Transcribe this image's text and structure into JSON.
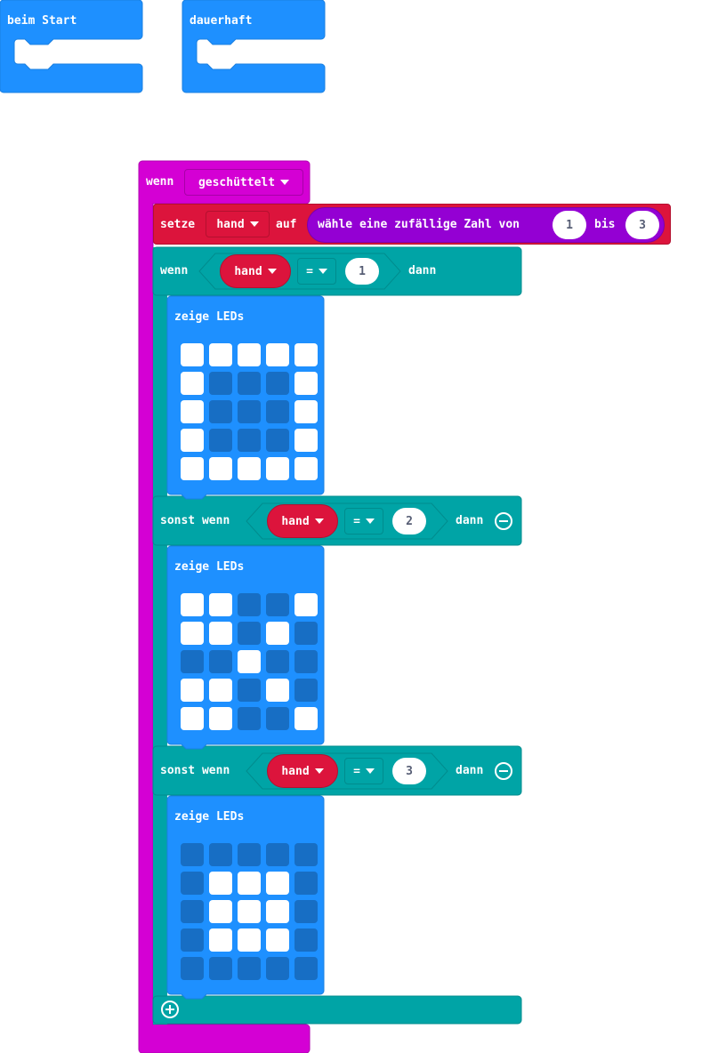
{
  "top_blocks": {
    "on_start_label": "beim Start",
    "forever_label": "dauerhaft"
  },
  "event": {
    "label": "wenn",
    "gesture": "geschüttelt"
  },
  "set_block": {
    "label": "setze",
    "variable": "hand",
    "to_label": "auf",
    "random_label": "wähle eine zufällige Zahl von",
    "from": "1",
    "between_label": "bis",
    "to": "3"
  },
  "if_block": {
    "if_label": "wenn",
    "then_label": "dann",
    "variable": "hand",
    "operator": "=",
    "value": "1",
    "show_leds_label": "zeige LEDs",
    "leds": [
      [
        1,
        1,
        1,
        1,
        1
      ],
      [
        1,
        0,
        0,
        0,
        1
      ],
      [
        1,
        0,
        0,
        0,
        1
      ],
      [
        1,
        0,
        0,
        0,
        1
      ],
      [
        1,
        1,
        1,
        1,
        1
      ]
    ]
  },
  "elseif_1": {
    "label": "sonst wenn",
    "then_label": "dann",
    "variable": "hand",
    "operator": "=",
    "value": "2",
    "show_leds_label": "zeige LEDs",
    "leds": [
      [
        1,
        1,
        0,
        0,
        1
      ],
      [
        1,
        1,
        0,
        1,
        0
      ],
      [
        0,
        0,
        1,
        0,
        0
      ],
      [
        1,
        1,
        0,
        1,
        0
      ],
      [
        1,
        1,
        0,
        0,
        1
      ]
    ]
  },
  "elseif_2": {
    "label": "sonst wenn",
    "then_label": "dann",
    "variable": "hand",
    "operator": "=",
    "value": "3",
    "show_leds_label": "zeige LEDs",
    "leds": [
      [
        0,
        0,
        0,
        0,
        0
      ],
      [
        0,
        1,
        1,
        1,
        0
      ],
      [
        0,
        1,
        1,
        1,
        0
      ],
      [
        0,
        1,
        1,
        1,
        0
      ],
      [
        0,
        0,
        0,
        0,
        0
      ]
    ]
  },
  "colors": {
    "basic_blue": "#1e90ff",
    "input_magenta": "#d400d4",
    "variables_red": "#dc143c",
    "math_purple": "#9400d3",
    "logic_teal": "#00a4a6"
  }
}
